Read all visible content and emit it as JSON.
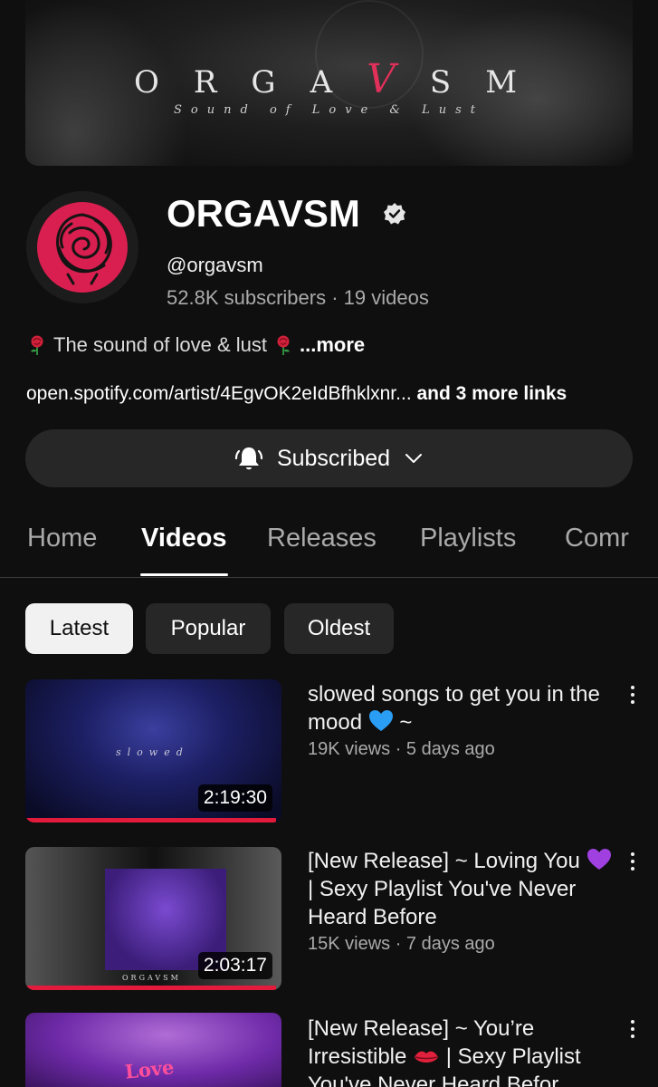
{
  "banner": {
    "title_pre": "ORGA",
    "title_v": "V",
    "title_post": "SM",
    "subtitle": "Sound of Love & Lust"
  },
  "channel": {
    "name": "ORGAVSM",
    "handle": "@orgavsm",
    "stats": "52.8K subscribers · 19 videos",
    "description": "The sound of love & lust",
    "more_label": "...more",
    "link_text": "open.spotify.com/artist/4EgvOK2eIdBfhklxnr...",
    "more_links": " and 3 more links",
    "subscribe_label": "Subscribed"
  },
  "tabs": [
    "Home",
    "Videos",
    "Releases",
    "Playlists",
    "Comr"
  ],
  "active_tab": "Videos",
  "chips": [
    "Latest",
    "Popular",
    "Oldest"
  ],
  "active_chip": "Latest",
  "videos": [
    {
      "title_a": "slowed songs to get you in the mood ",
      "title_b": " ~",
      "meta": "19K views · 5 days ago",
      "duration": "2:19:30",
      "thumb_text": "slowed",
      "watched_fraction": 0.98
    },
    {
      "title_a": "[New Release] ~ Loving You ",
      "title_b": " | Sexy Playlist You've Never Heard Before",
      "meta": "15K views · 7 days ago",
      "duration": "2:03:17",
      "thumb_text": "ORGAVSM",
      "watched_fraction": 0.98
    },
    {
      "title_a": "[New Release] ~ You’re Irresistible ",
      "title_b": " | Sexy Playlist You've Never Heard Befor",
      "thumb_text": "Love"
    }
  ],
  "colors": {
    "background": "#0f0f0f",
    "accent_red": "#e21b3c",
    "rose": "#d91f4f",
    "chip_bg": "#272727"
  },
  "icons": {
    "verified": "verified-badge-icon",
    "bell": "bell-ringing-icon",
    "chevron": "chevron-down-icon",
    "more": "more-vertical-icon",
    "rose": "rose-emoji-icon",
    "heart_blue": "blue-heart-emoji-icon",
    "heart_purple": "purple-heart-emoji-icon",
    "kiss": "kiss-mark-emoji-icon"
  }
}
